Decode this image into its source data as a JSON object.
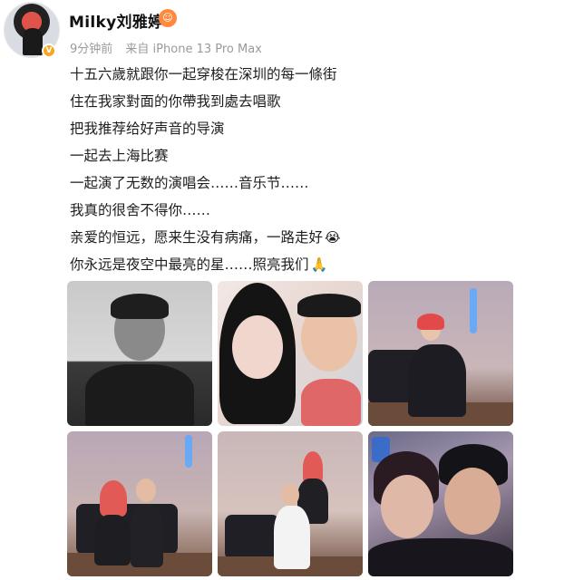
{
  "post": {
    "username": "Milky刘雅婷",
    "verified_badge": "V",
    "level_icon": "orange-emoji-icon",
    "time_ago": "9分钟前",
    "source": "来自 iPhone 13 Pro Max",
    "lines": [
      "十五六歲就跟你一起穿梭在深圳的每一條街",
      "住在我家對面的你帶我到處去唱歌",
      "把我推荐给好声音的导演",
      "一起去上海比赛",
      "一起演了无数的演唱会……音乐节……",
      "我真的很舍不得你……",
      "亲爱的恒远，愿来生没有病痛，一路走好",
      "你永远是夜空中最亮的星……照亮我们"
    ],
    "emojis": {
      "crying": "😭",
      "pray": "🙏"
    }
  },
  "colors": {
    "badge": "#f5a623",
    "meta_text": "#9a9a9a",
    "level_icon": "#ff8a3d"
  }
}
